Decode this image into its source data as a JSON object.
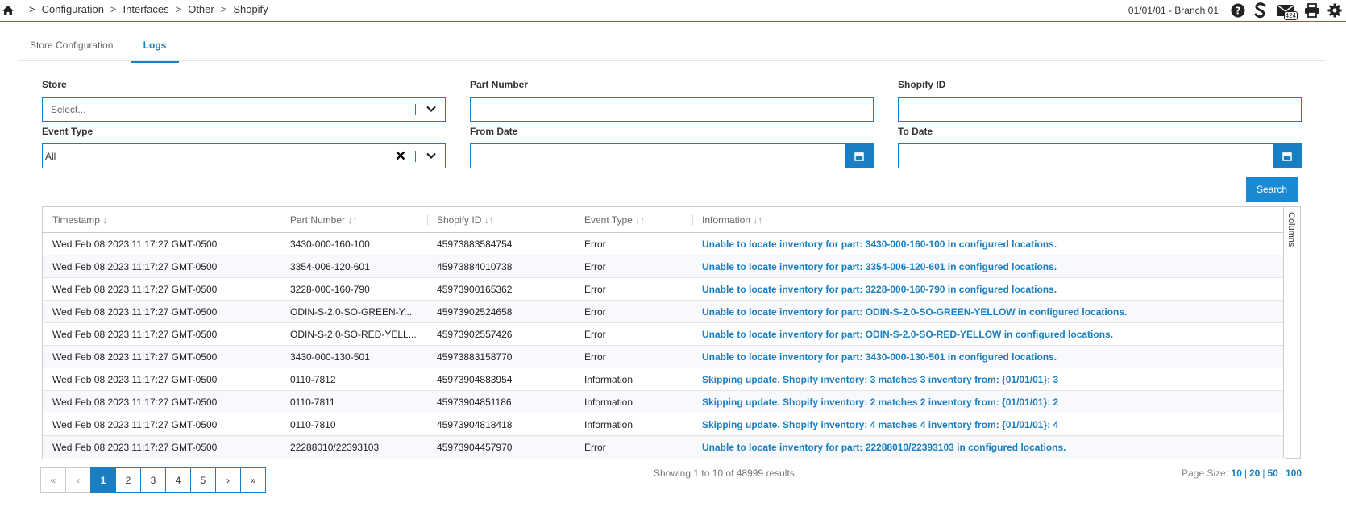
{
  "breadcrumb": {
    "sep": ">",
    "items": [
      "Configuration",
      "Interfaces",
      "Other",
      "Shopify"
    ]
  },
  "header": {
    "branch": "01/01/01 - Branch 01",
    "mail_count": "424",
    "icons": [
      "home-icon",
      "help-icon",
      "s-logo-icon",
      "mail-icon",
      "print-icon",
      "gear-icon"
    ]
  },
  "tabs": [
    {
      "label": "Store Configuration",
      "active": false
    },
    {
      "label": "Logs",
      "active": true
    }
  ],
  "filters": {
    "store": {
      "label": "Store",
      "placeholder": "Select..."
    },
    "part_number": {
      "label": "Part Number",
      "value": ""
    },
    "shopify_id": {
      "label": "Shopify ID",
      "value": ""
    },
    "event_type": {
      "label": "Event Type",
      "value": "All"
    },
    "from_date": {
      "label": "From Date",
      "value": ""
    },
    "to_date": {
      "label": "To Date",
      "value": ""
    },
    "search_label": "Search"
  },
  "table": {
    "columns": [
      "Timestamp",
      "Part Number",
      "Shopify ID",
      "Event Type",
      "Information"
    ],
    "sort_glyphs": [
      "↓",
      "↓↑",
      "↓↑",
      "↓↑",
      "↓↑"
    ],
    "columns_panel_label": "Columns",
    "rows": [
      [
        "Wed Feb 08 2023 11:17:27 GMT-0500",
        "3430-000-160-100",
        "45973883584754",
        "Error",
        "Unable to locate inventory for part: 3430-000-160-100 in configured locations."
      ],
      [
        "Wed Feb 08 2023 11:17:27 GMT-0500",
        "3354-006-120-601",
        "45973884010738",
        "Error",
        "Unable to locate inventory for part: 3354-006-120-601 in configured locations."
      ],
      [
        "Wed Feb 08 2023 11:17:27 GMT-0500",
        "3228-000-160-790",
        "45973900165362",
        "Error",
        "Unable to locate inventory for part: 3228-000-160-790 in configured locations."
      ],
      [
        "Wed Feb 08 2023 11:17:27 GMT-0500",
        "ODIN-S-2.0-SO-GREEN-Y...",
        "45973902524658",
        "Error",
        "Unable to locate inventory for part: ODIN-S-2.0-SO-GREEN-YELLOW in configured locations."
      ],
      [
        "Wed Feb 08 2023 11:17:27 GMT-0500",
        "ODIN-S-2.0-SO-RED-YELL...",
        "45973902557426",
        "Error",
        "Unable to locate inventory for part: ODIN-S-2.0-SO-RED-YELLOW in configured locations."
      ],
      [
        "Wed Feb 08 2023 11:17:27 GMT-0500",
        "3430-000-130-501",
        "45973883158770",
        "Error",
        "Unable to locate inventory for part: 3430-000-130-501 in configured locations."
      ],
      [
        "Wed Feb 08 2023 11:17:27 GMT-0500",
        "0110-7812",
        "45973904883954",
        "Information",
        "Skipping update. Shopify inventory: 3 matches 3 inventory from: {01/01/01}: 3"
      ],
      [
        "Wed Feb 08 2023 11:17:27 GMT-0500",
        "0110-7811",
        "45973904851186",
        "Information",
        "Skipping update. Shopify inventory: 2 matches 2 inventory from: {01/01/01}: 2"
      ],
      [
        "Wed Feb 08 2023 11:17:27 GMT-0500",
        "0110-7810",
        "45973904818418",
        "Information",
        "Skipping update. Shopify inventory: 4 matches 4 inventory from: {01/01/01}: 4"
      ],
      [
        "Wed Feb 08 2023 11:17:27 GMT-0500",
        "22288010/22393103",
        "45973904457970",
        "Error",
        "Unable to locate inventory for part: 22288010/22393103 in configured locations."
      ]
    ]
  },
  "pager": {
    "first": "«",
    "prev": "‹",
    "pages": [
      "1",
      "2",
      "3",
      "4",
      "5"
    ],
    "next": "›",
    "last": "»",
    "active_page": "1",
    "showing": "Showing 1 to 10 of 48999 results",
    "page_size_label": "Page Size:",
    "page_sizes": [
      "10",
      "20",
      "50",
      "100"
    ]
  },
  "colors": {
    "accent": "#1a7fc2",
    "button": "#1a8ad4"
  }
}
